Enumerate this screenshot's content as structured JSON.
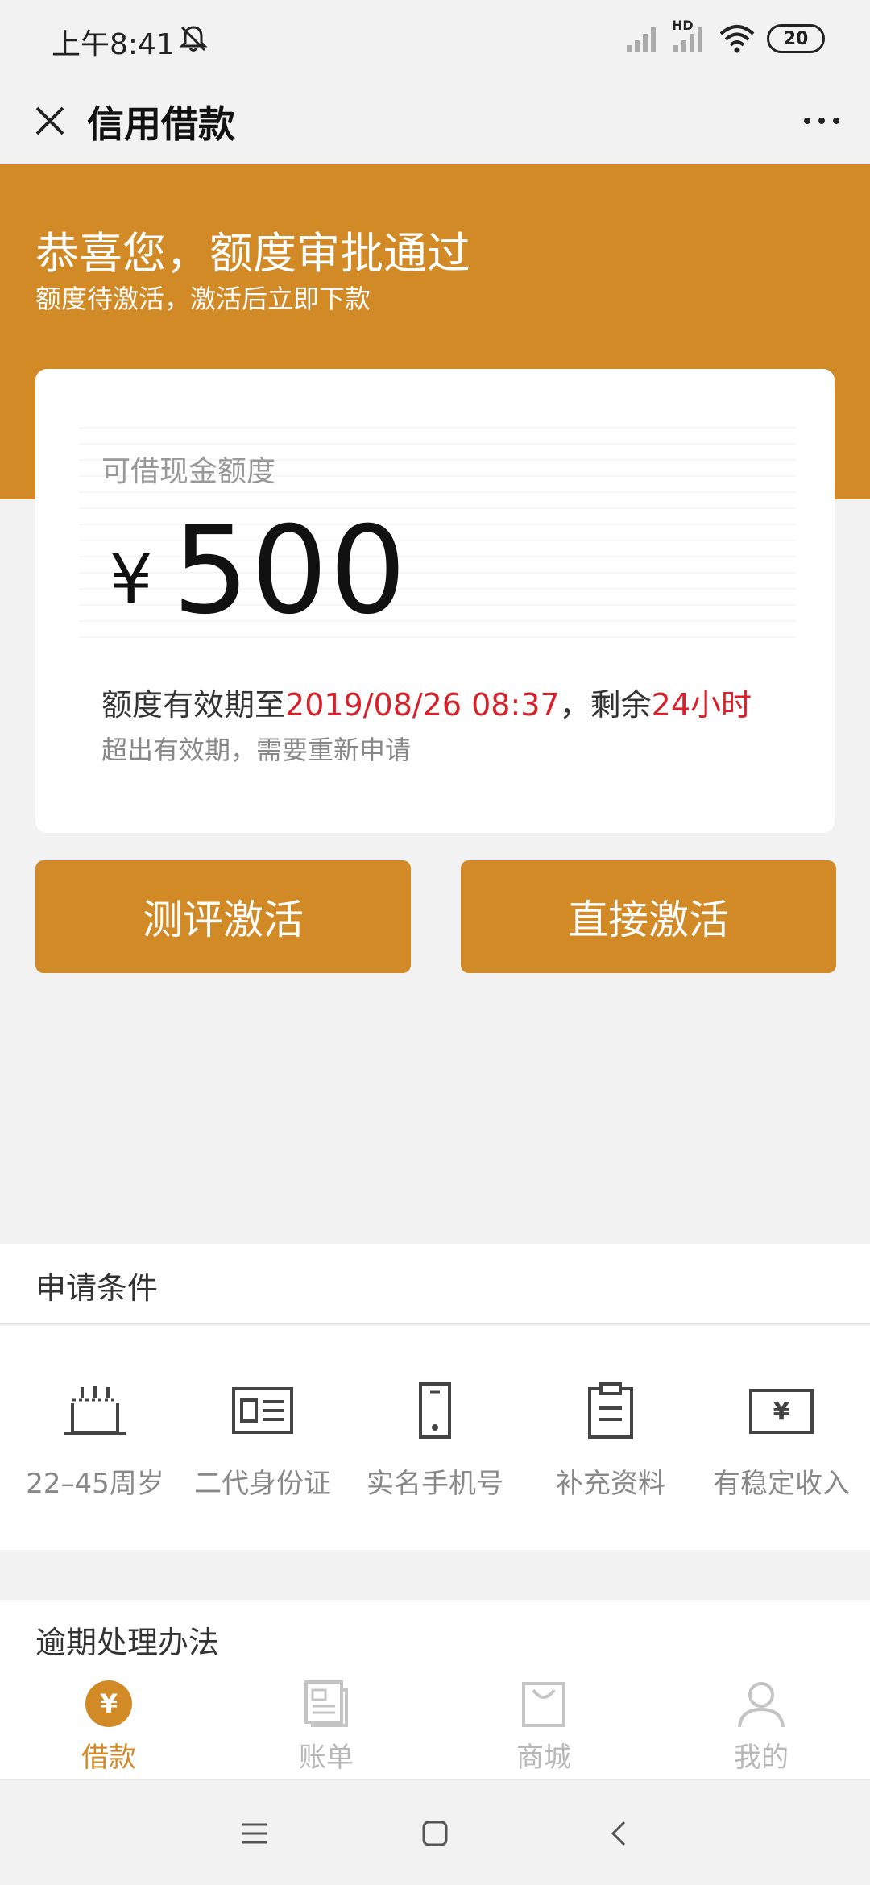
{
  "status_bar": {
    "time": "上午8:41",
    "network": "HD",
    "battery": "20",
    "icons": [
      "bell-muted-icon",
      "signal-icon",
      "signal-hd-icon",
      "wifi-icon",
      "battery-icon"
    ]
  },
  "header": {
    "title": "信用借款",
    "close_icon": "close-icon",
    "more_icon": "more-icon"
  },
  "banner": {
    "title": "恭喜您，额度审批通过",
    "subtitle": "额度待激活，激活后立即下款",
    "color": "#d18a25"
  },
  "credit_card": {
    "label": "可借现金额度",
    "currency": "¥",
    "amount": "500",
    "valid_prefix": "额度有效期至",
    "valid_date": "2019/08/26 08:37",
    "valid_mid": "，剩余",
    "remaining": "24小时",
    "note": "超出有效期，需要重新申请",
    "highlight_color": "#d8202a"
  },
  "actions": {
    "evaluate_label": "测评激活",
    "direct_label": "直接激活"
  },
  "conditions": {
    "title": "申请条件",
    "items": [
      {
        "label": "22–45周岁",
        "icon": "cake-icon"
      },
      {
        "label": "二代身份证",
        "icon": "id-card-icon"
      },
      {
        "label": "实名手机号",
        "icon": "phone-icon"
      },
      {
        "label": "补充资料",
        "icon": "clipboard-icon"
      },
      {
        "label": "有稳定收入",
        "icon": "cash-icon"
      }
    ]
  },
  "overdue": {
    "title": "逾期处理办法"
  },
  "tabs": [
    {
      "label": "借款",
      "icon": "yen-circle-icon",
      "active": true
    },
    {
      "label": "账单",
      "icon": "bill-icon",
      "active": false
    },
    {
      "label": "商城",
      "icon": "shopping-bag-icon",
      "active": false
    },
    {
      "label": "我的",
      "icon": "user-icon",
      "active": false
    }
  ],
  "nav": {
    "icons": [
      "menu-icon",
      "home-icon",
      "back-icon"
    ]
  }
}
